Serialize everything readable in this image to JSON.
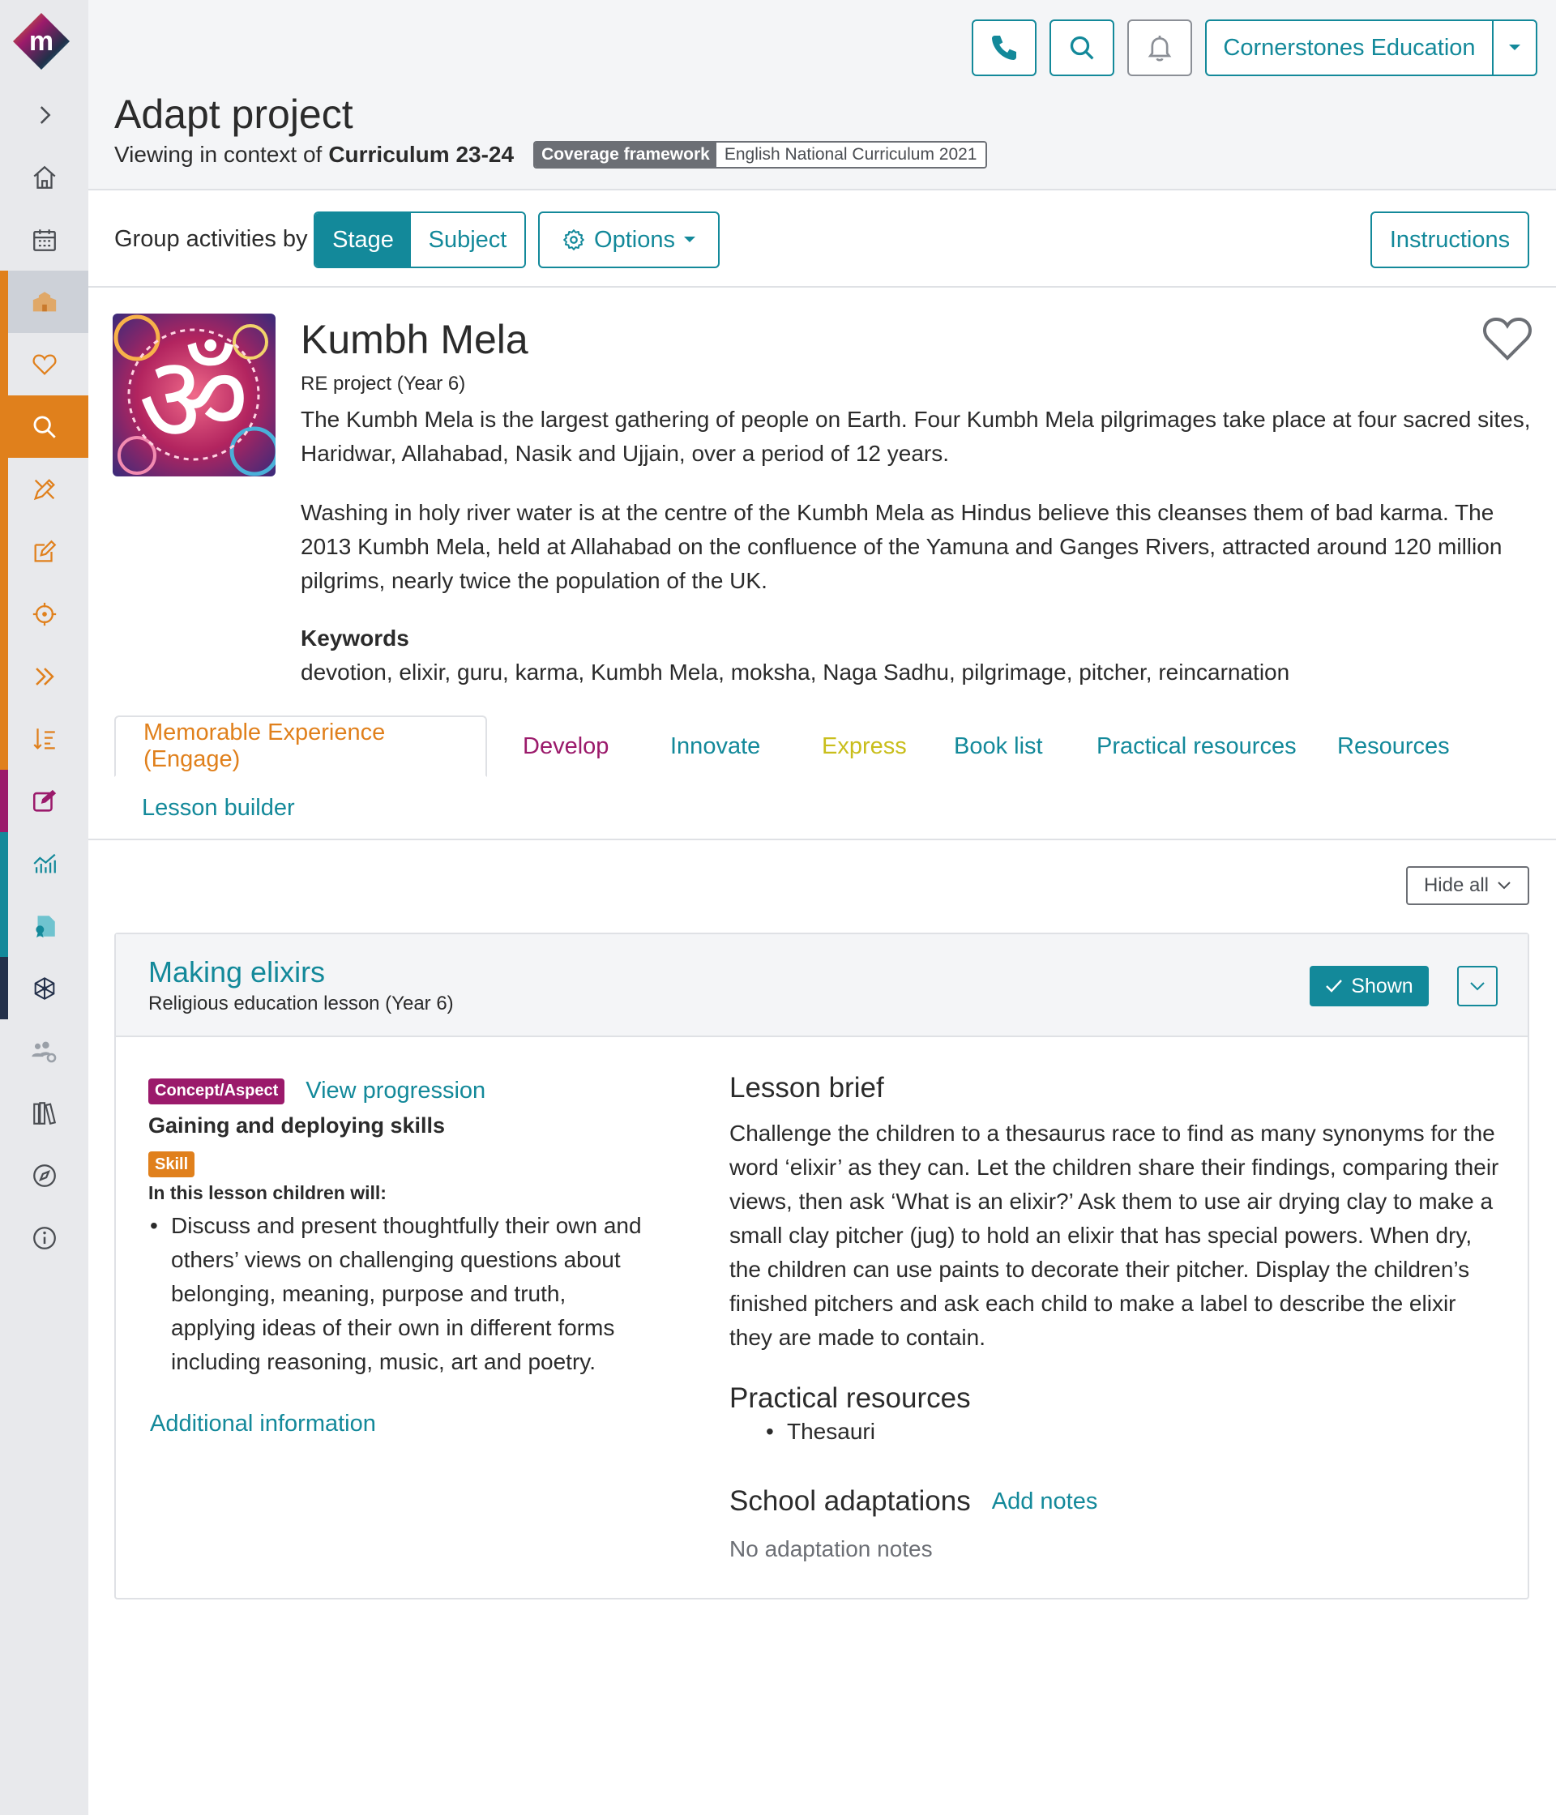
{
  "colors": {
    "accent": "#13899a",
    "orange": "#e0801c",
    "magenta": "#9b1a6b",
    "navy": "#23304a",
    "tab_develop": "#9b1a6b",
    "tab_express": "#c9be1c"
  },
  "sidebar": {
    "logo_letter": "m",
    "items": [
      {
        "icon": "chevron-right-icon"
      },
      {
        "icon": "home-icon"
      },
      {
        "icon": "calendar-icon"
      },
      {
        "icon": "school-icon"
      },
      {
        "icon": "heart-icon"
      },
      {
        "icon": "search-icon"
      },
      {
        "icon": "pencil-ruler-icon"
      },
      {
        "icon": "edit-icon"
      },
      {
        "icon": "target-icon"
      },
      {
        "icon": "double-chevron-icon"
      },
      {
        "icon": "sort-list-icon"
      },
      {
        "icon": "edit-square-icon"
      },
      {
        "icon": "chart-icon"
      },
      {
        "icon": "certificate-icon"
      },
      {
        "icon": "network-icon"
      },
      {
        "icon": "users-settings-icon"
      },
      {
        "icon": "library-icon"
      },
      {
        "icon": "compass-icon"
      },
      {
        "icon": "info-icon"
      }
    ]
  },
  "topbar": {
    "phone_icon": "phone-icon",
    "search_icon": "search-icon",
    "bell_icon": "bell-icon",
    "org_name": "Cornerstones Education"
  },
  "header": {
    "title": "Adapt project",
    "context_prefix": "Viewing in context of",
    "context_value": "Curriculum 23-24",
    "framework_label": "Coverage framework",
    "framework_value": "English National Curriculum 2021"
  },
  "toolbar": {
    "group_label": "Group activities by",
    "stage_label": "Stage",
    "subject_label": "Subject",
    "options_label": "Options",
    "instructions_label": "Instructions"
  },
  "project": {
    "title": "Kumbh Mela",
    "subtitle": "RE project (Year 6)",
    "paragraphs": [
      "The Kumbh Mela is the largest gathering of people on Earth. Four Kumbh Mela pilgrimages take place at four sacred sites, Haridwar, Allahabad, Nasik and Ujjain, over a period of 12 years.",
      "Washing in holy river water is at the centre of the Kumbh Mela as Hindus believe this cleanses them of bad karma. The 2013 Kumbh Mela, held at Allahabad on the confluence of the Yamuna and Ganges Rivers, attracted around 120 million pilgrims, nearly twice the population of the UK."
    ],
    "keywords_title": "Keywords",
    "keywords": "devotion, elixir, guru, karma, Kumbh Mela, moksha, Naga Sadhu, pilgrimage, pitcher, reincarnation"
  },
  "tabs": [
    {
      "label": "Memorable Experience (Engage)",
      "color": "#e0801c"
    },
    {
      "label": "Develop",
      "color": "#9b1a6b"
    },
    {
      "label": "Innovate",
      "color": "#13899a"
    },
    {
      "label": "Express",
      "color": "#c9be1c"
    },
    {
      "label": "Book list",
      "color": "#13899a"
    },
    {
      "label": "Practical resources",
      "color": "#13899a"
    },
    {
      "label": "Resources",
      "color": "#13899a"
    },
    {
      "label": "Lesson builder",
      "color": "#13899a"
    }
  ],
  "hide_all_label": "Hide all",
  "lesson": {
    "title": "Making elixirs",
    "subtitle": "Religious education lesson (Year 6)",
    "shown_label": "Shown",
    "concept_tag": "Concept/Aspect",
    "view_progression": "View progression",
    "skill_title": "Gaining and deploying skills",
    "skill_tag": "Skill",
    "children_will": "In this lesson children will:",
    "objectives": [
      "Discuss and present thoughtfully their own and others’ views on challenging questions about belonging, meaning, purpose and truth, applying ideas of their own in different forms including reasoning, music, art and poetry."
    ],
    "additional_info": "Additional information",
    "brief_title": "Lesson brief",
    "brief_text": "Challenge the children to a thesaurus race to find as many synonyms for the word ‘elixir’ as they can. Let the children share their findings, comparing their views, then ask ‘What is an elixir?’ Ask them to use air drying clay to make a small clay pitcher (jug) to hold an elixir that has special powers. When dry, the children can use paints to decorate their pitcher. Display the children’s finished pitchers and ask each child to make a label to describe the elixir they are made to contain.",
    "practical_title": "Practical resources",
    "practical_items": [
      "Thesauri"
    ],
    "adaptations_title": "School adaptations",
    "add_notes": "Add notes",
    "no_notes": "No adaptation notes"
  }
}
